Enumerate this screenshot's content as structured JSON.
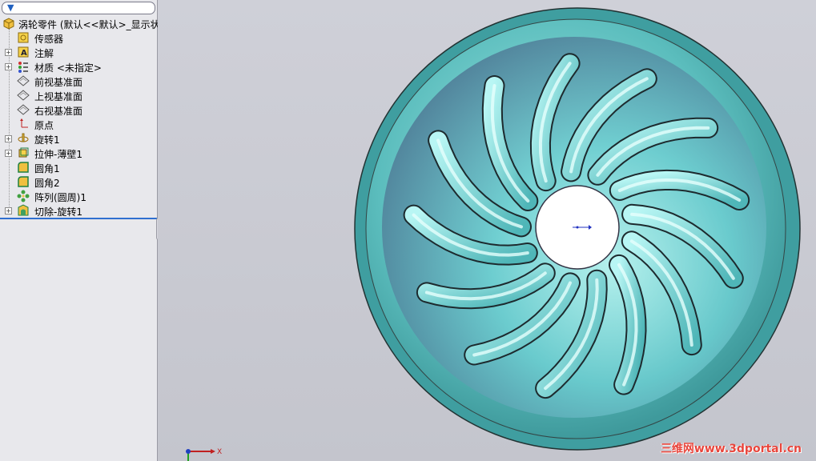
{
  "feature_tree": {
    "root_label": "涡轮零件  (默认<<默认>_显示状",
    "items": [
      {
        "label": "传感器",
        "expandable": false,
        "icon": "sensor-icon"
      },
      {
        "label": "注解",
        "expandable": true,
        "icon": "annotation-icon"
      },
      {
        "label": "材质 <未指定>",
        "expandable": true,
        "icon": "material-icon"
      },
      {
        "label": "前视基准面",
        "expandable": false,
        "icon": "plane-icon"
      },
      {
        "label": "上视基准面",
        "expandable": false,
        "icon": "plane-icon"
      },
      {
        "label": "右视基准面",
        "expandable": false,
        "icon": "plane-icon"
      },
      {
        "label": "原点",
        "expandable": false,
        "icon": "origin-icon"
      },
      {
        "label": "旋转1",
        "expandable": true,
        "icon": "revolve-icon"
      },
      {
        "label": "拉伸-薄壁1",
        "expandable": true,
        "icon": "extrude-icon"
      },
      {
        "label": "圆角1",
        "expandable": false,
        "icon": "fillet-icon"
      },
      {
        "label": "圆角2",
        "expandable": false,
        "icon": "fillet-icon"
      },
      {
        "label": "阵列(圆周)1",
        "expandable": false,
        "icon": "circular-pattern-icon"
      },
      {
        "label": "切除-旋转1",
        "expandable": true,
        "icon": "cut-revolve-icon"
      }
    ]
  },
  "viewport": {
    "triad_x_label": "X",
    "watermark": "三维网www.3dportal.cn",
    "model_colors": {
      "body": "#5fc4c4",
      "rim": "#4a9c9c",
      "inner": "#3e7e86",
      "slot": "#7fe8e8",
      "edge": "#1a2a2a"
    },
    "slot_count": 13
  }
}
